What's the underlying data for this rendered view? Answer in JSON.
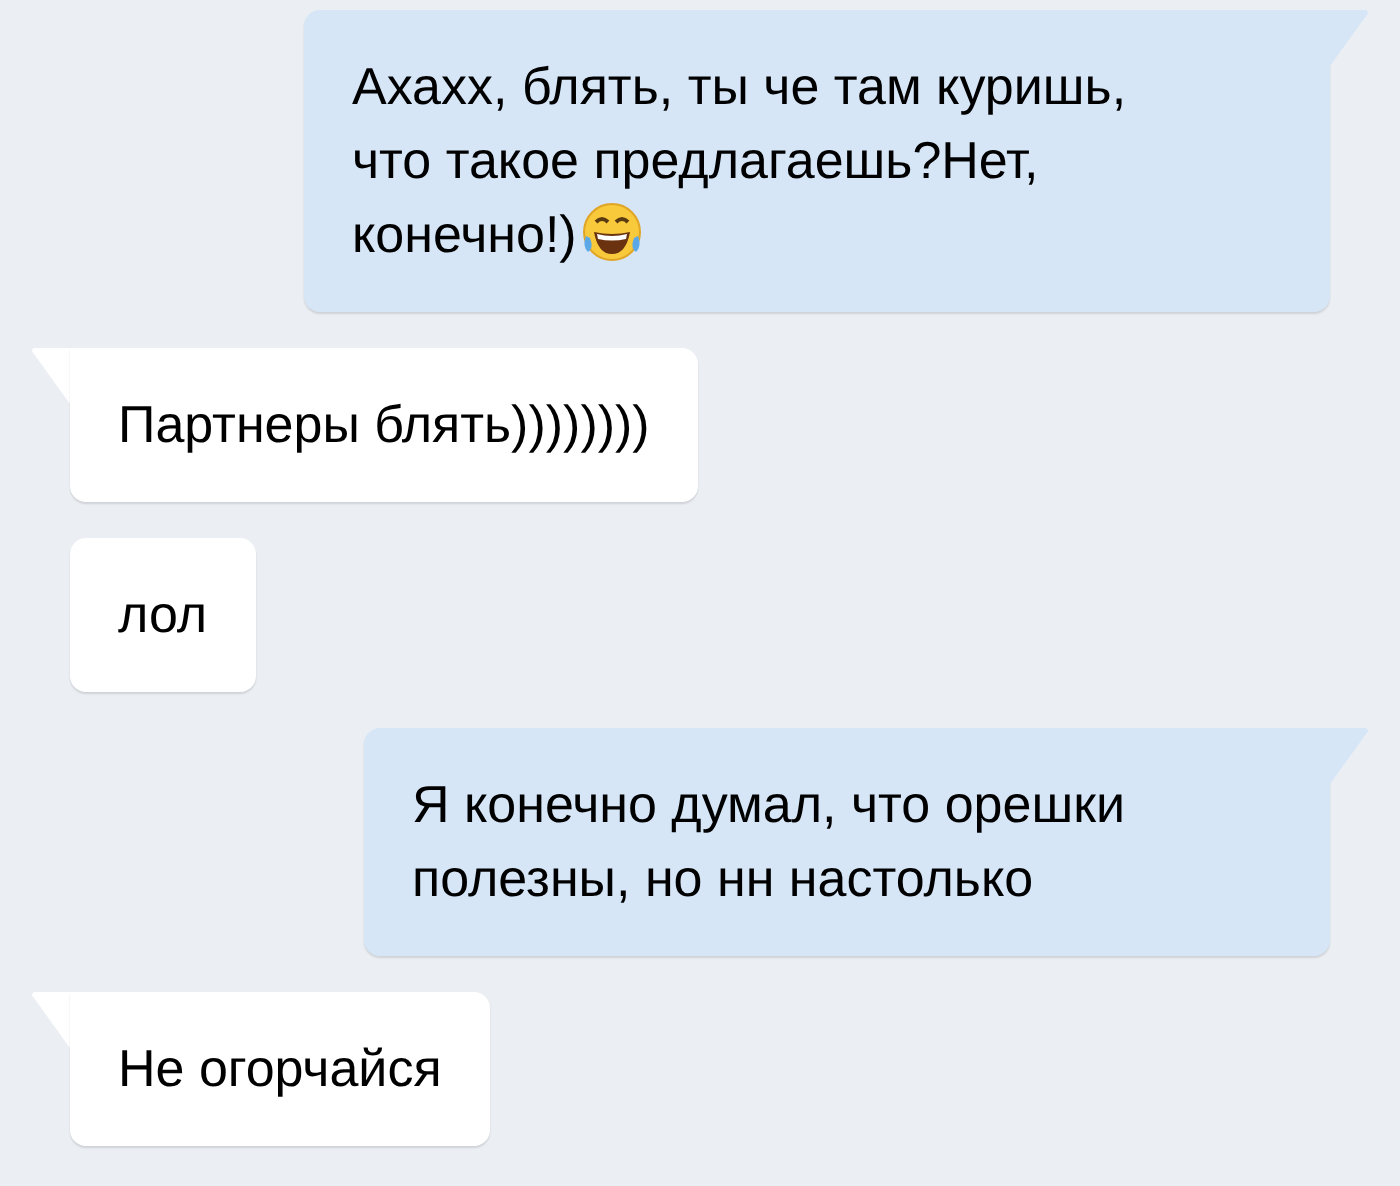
{
  "messages": [
    {
      "outgoing": true,
      "tail": true,
      "text": "Ахахх, блять, ты че там куришь, что такое предлагаешь?Нет, конечно!)",
      "emoji": true
    },
    {
      "outgoing": false,
      "tail": true,
      "text": "Партнеры блять))))))))",
      "emoji": false
    },
    {
      "outgoing": false,
      "tail": false,
      "text": "лол",
      "emoji": false
    },
    {
      "outgoing": true,
      "tail": true,
      "text": "Я конечно думал, что орешки полезны, но нн настолько",
      "emoji": false
    },
    {
      "outgoing": false,
      "tail": true,
      "text": "Не огорчайся",
      "emoji": false
    }
  ]
}
